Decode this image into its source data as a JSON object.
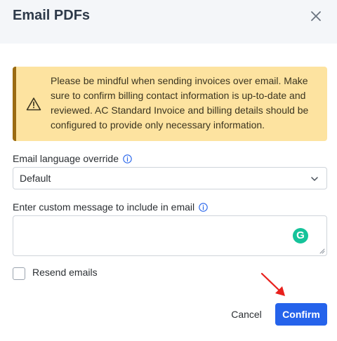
{
  "dialog": {
    "title": "Email PDFs",
    "close_icon": "close-icon"
  },
  "alert": {
    "icon": "warning-icon",
    "text": "Please be mindful when sending invoices over email. Make sure to confirm billing contact information is up-to-date and reviewed. AC Standard Invoice and billing details should be configured to provide only necessary information."
  },
  "language": {
    "label": "Email language override",
    "selected": "Default"
  },
  "message": {
    "label": "Enter custom message to include in email",
    "value": ""
  },
  "resend": {
    "label": "Resend emails",
    "checked": false
  },
  "actions": {
    "cancel": "Cancel",
    "confirm": "Confirm"
  },
  "colors": {
    "primary": "#2563eb",
    "alert_bg": "#fde3a0",
    "alert_bar": "#9b6b12",
    "annotation_arrow": "#e8201c"
  }
}
